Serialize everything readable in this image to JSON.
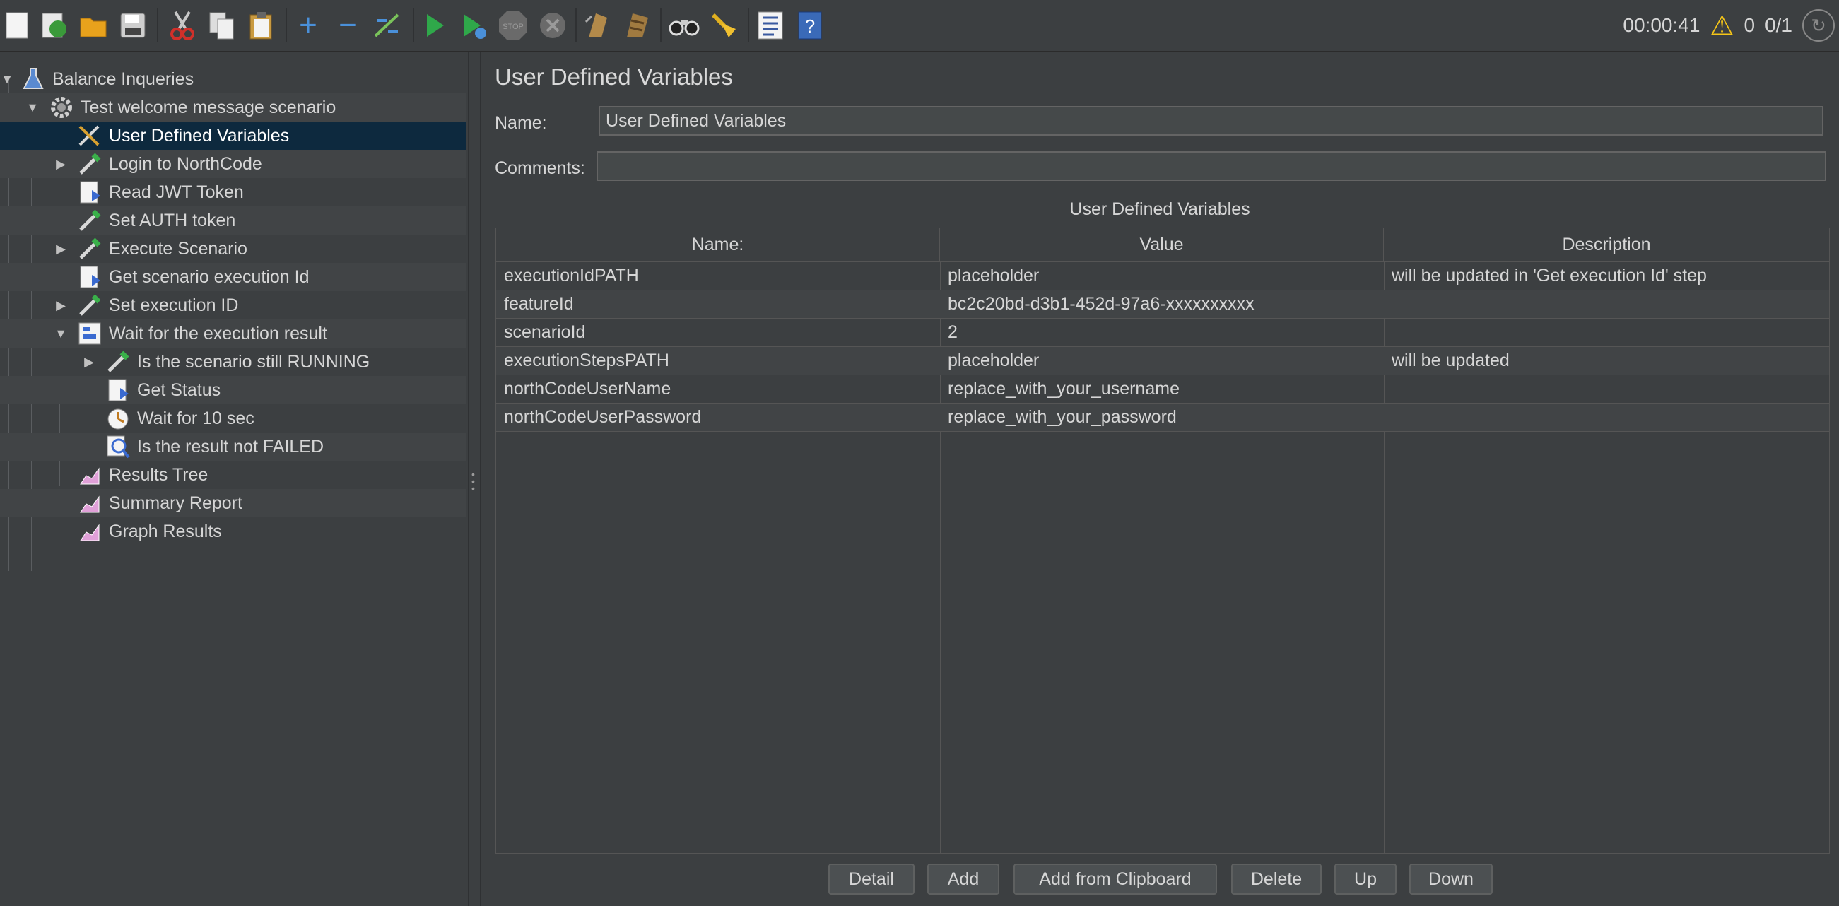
{
  "toolbar": {
    "icons": [
      "new-icon",
      "templates-icon",
      "open-icon",
      "save-icon",
      "cut-icon",
      "copy-icon",
      "paste-icon",
      "expand-icon",
      "collapse-icon",
      "toggle-icon",
      "start-icon",
      "start-no-pause-icon",
      "stop-icon",
      "shutdown-icon",
      "clear-icon",
      "clear-all-icon",
      "search-icon",
      "reset-search-icon",
      "function-helper-icon",
      "help-icon"
    ],
    "timer": "00:00:41",
    "warnings": "0",
    "threads": "0/1"
  },
  "tree": {
    "items": [
      {
        "label": "Balance Inqueries",
        "icon": "flask-icon"
      },
      {
        "label": "Test welcome message scenario",
        "icon": "gear-icon"
      },
      {
        "label": "User Defined Variables",
        "icon": "tools-icon"
      },
      {
        "label": "Login to NorthCode",
        "icon": "pipette-icon"
      },
      {
        "label": "Read JWT Token",
        "icon": "script-icon"
      },
      {
        "label": "Set AUTH token",
        "icon": "pipette-icon"
      },
      {
        "label": "Execute Scenario",
        "icon": "pipette-icon"
      },
      {
        "label": "Get scenario execution Id",
        "icon": "script-icon"
      },
      {
        "label": "Set execution ID",
        "icon": "pipette-icon"
      },
      {
        "label": "Wait for the execution result",
        "icon": "while-controller-icon"
      },
      {
        "label": "Is the scenario still RUNNING",
        "icon": "pipette-icon"
      },
      {
        "label": "Get Status",
        "icon": "script-icon"
      },
      {
        "label": "Wait for 10 sec",
        "icon": "timer-icon"
      },
      {
        "label": "Is the result not FAILED",
        "icon": "assertion-icon"
      },
      {
        "label": "Results Tree",
        "icon": "listener-icon"
      },
      {
        "label": "Summary Report",
        "icon": "listener-icon"
      },
      {
        "label": "Graph Results",
        "icon": "listener-icon"
      }
    ]
  },
  "panel": {
    "title": "User Defined Variables",
    "name_label": "Name:",
    "name_value": "User Defined Variables",
    "comments_label": "Comments:",
    "comments_value": "",
    "table_caption": "User Defined Variables",
    "columns": [
      "Name:",
      "Value",
      "Description"
    ],
    "rows": [
      [
        "executionIdPATH",
        "placeholder",
        "will be updated in 'Get execution Id' step"
      ],
      [
        "featureId",
        "bc2c20bd-d3b1-452d-97a6-xxxxxxxxxx",
        ""
      ],
      [
        "scenarioId",
        "2",
        ""
      ],
      [
        "executionStepsPATH",
        "placeholder",
        "will be updated"
      ],
      [
        "northCodeUserName",
        "replace_with_your_username",
        ""
      ],
      [
        "northCodeUserPassword",
        "replace_with_your_password",
        ""
      ]
    ],
    "buttons": [
      "Detail",
      "Add",
      "Add from Clipboard",
      "Delete",
      "Up",
      "Down"
    ]
  },
  "colors": {
    "background": "#3c3f41",
    "selection": "#0d293e",
    "text": "#d6d6d6"
  }
}
